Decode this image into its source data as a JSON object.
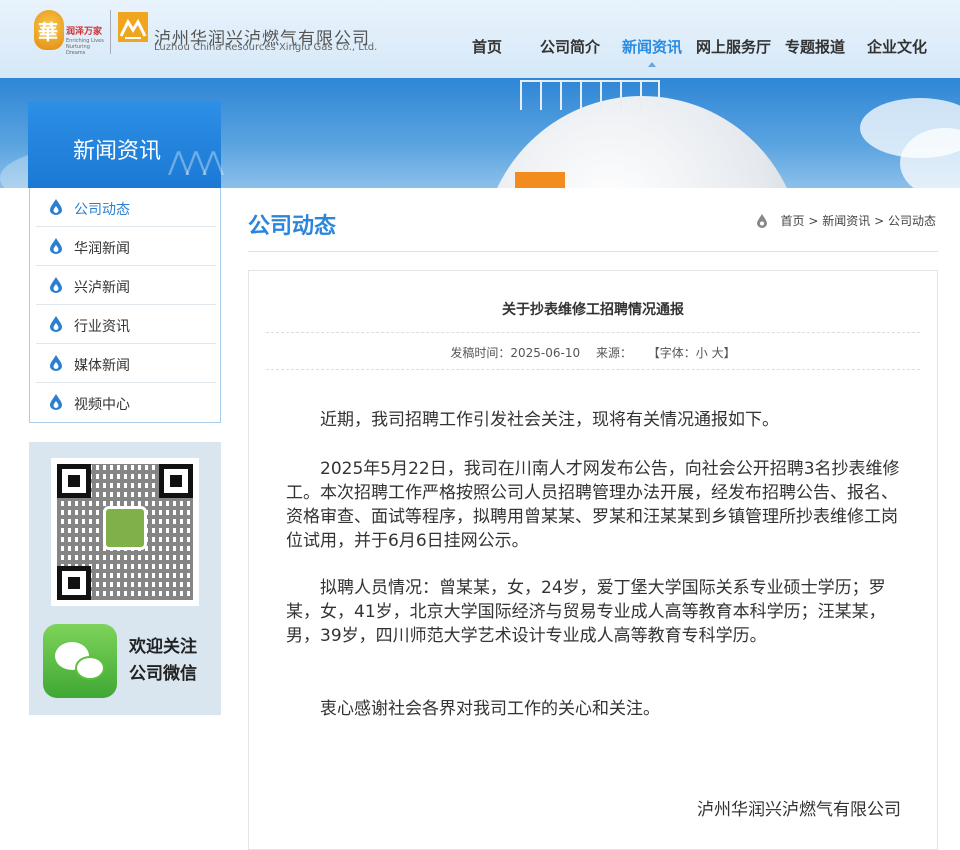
{
  "header": {
    "logo_crs_text": "華",
    "logo_crs_slogan": "润泽万家",
    "logo_crs_sub": "Enriching Lives Nurturing Dreams",
    "company_cn": "泸州华润兴泸燃气有限公司",
    "company_en": "Luzhou China Resources Xinglu Gas Co., Ltd."
  },
  "nav": {
    "items": [
      "首页",
      "公司简介",
      "新闻资讯",
      "网上服务厅",
      "专题报道",
      "企业文化"
    ],
    "active_index": 2
  },
  "banner": {
    "section_title": "新闻资讯"
  },
  "sidebar": {
    "items": [
      "公司动态",
      "华润新闻",
      "兴泸新闻",
      "行业资讯",
      "媒体新闻",
      "视频中心"
    ],
    "active_index": 0,
    "wechat_line1": "欢迎关注",
    "wechat_line2": "公司微信"
  },
  "main": {
    "heading": "公司动态",
    "breadcrumb": [
      "首页",
      "新闻资讯",
      "公司动态"
    ],
    "breadcrumb_sep": ">"
  },
  "article": {
    "title": "关于抄表维修工招聘情况通报",
    "meta_date": "发稿时间：2025-06-10",
    "meta_source": "来源：",
    "meta_font": "【字体：小 大】",
    "paragraphs": [
      "近期，我司招聘工作引发社会关注，现将有关情况通报如下。",
      "2025年5月22日，我司在川南人才网发布公告，向社会公开招聘3名抄表维修工。本次招聘工作严格按照公司人员招聘管理办法开展，经发布招聘公告、报名、资格审查、面试等程序，拟聘用曾某某、罗某和汪某某到乡镇管理所抄表维修工岗位试用，并于6月6日挂网公示。",
      "拟聘人员情况：曾某某，女，24岁，爱丁堡大学国际关系专业硕士学历；罗某，女，41岁，北京大学国际经济与贸易专业成人高等教育本科学历；汪某某，男，39岁，四川师范大学艺术设计专业成人高等教育专科学历。",
      "衷心感谢社会各界对我司工作的关心和关注。"
    ],
    "signature": "泸州华润兴泸燃气有限公司"
  },
  "colors": {
    "accent": "#2a86db",
    "nav_active": "#2a8be0",
    "header_bg": "#e9f3fc",
    "logo_orange": "#f0a51e"
  }
}
